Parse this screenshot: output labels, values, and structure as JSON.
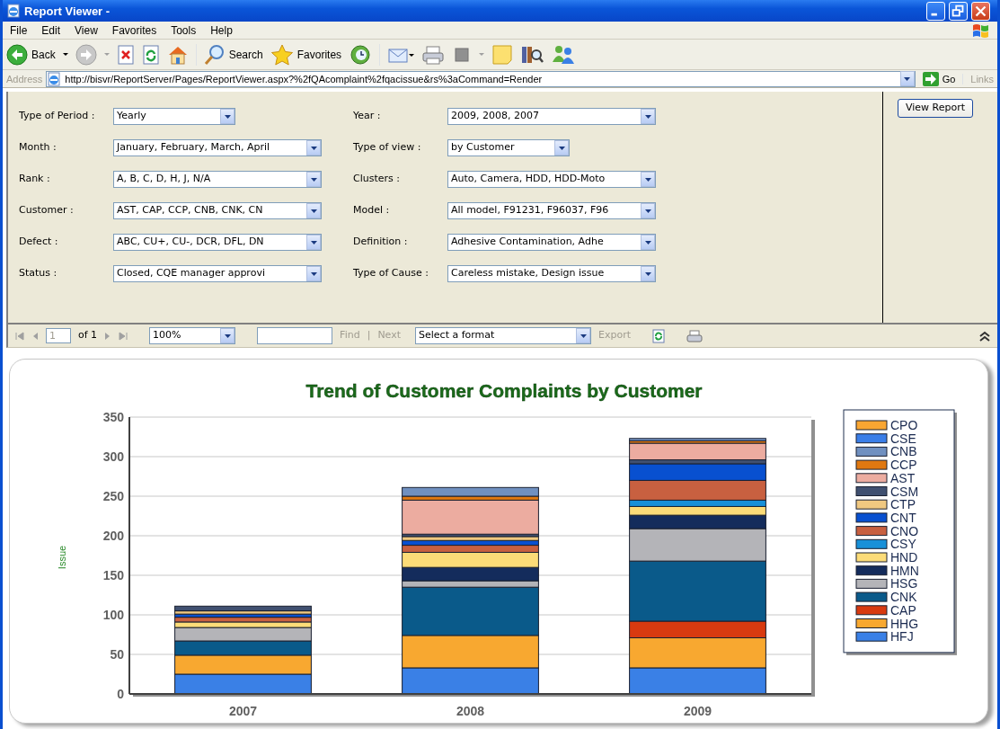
{
  "window": {
    "title": "Report Viewer -"
  },
  "menu": [
    "File",
    "Edit",
    "View",
    "Favorites",
    "Tools",
    "Help"
  ],
  "toolbar": {
    "back_label": "Back",
    "search_label": "Search",
    "favorites_label": "Favorites"
  },
  "address_bar": {
    "label": "Address",
    "url": "http://bisvr/ReportServer/Pages/ReportViewer.aspx?%2fQAcomplaint%2fqacissue&rs%3aCommand=Render",
    "go_label": "Go",
    "links_label": "Links"
  },
  "parameters": [
    {
      "label": "Type of Period :",
      "value": "Yearly",
      "kind": "short"
    },
    {
      "label": "Year :",
      "value": "2009, 2008, 2007",
      "kind": "wide"
    },
    {
      "label": "Month :",
      "value": "January, February, March, April",
      "kind": "wide"
    },
    {
      "label": "Type of view :",
      "value": "by Customer",
      "kind": "short"
    },
    {
      "label": "Rank :",
      "value": "A, B, C, D, H, J, N/A",
      "kind": "wide"
    },
    {
      "label": "Clusters :",
      "value": "Auto, Camera, HDD, HDD-Moto",
      "kind": "wide"
    },
    {
      "label": "Customer :",
      "value": "AST, CAP, CCP, CNB, CNK, CN",
      "kind": "wide"
    },
    {
      "label": "Model :",
      "value": "All model, F91231, F96037, F96",
      "kind": "wide"
    },
    {
      "label": "Defect :",
      "value": "ABC, CU+, CU-, DCR, DFL, DN",
      "kind": "wide"
    },
    {
      "label": "Definition :",
      "value": "Adhesive Contamination, Adhe",
      "kind": "wide"
    },
    {
      "label": "Status :",
      "value": "Closed, CQE manager approvi",
      "kind": "wide"
    },
    {
      "label": "Type of Cause :",
      "value": "Careless mistake, Design issue",
      "kind": "wide"
    }
  ],
  "view_report_button": "View Report",
  "report_toolbar": {
    "page": "1",
    "page_count": "of 1",
    "zoom": "100%",
    "find": {
      "label": "Find",
      "disabled": true
    },
    "separator": "|",
    "next": {
      "label": "Next",
      "disabled": true
    },
    "format": "Select a format",
    "export": {
      "label": "Export",
      "disabled": true
    }
  },
  "report_chart": {
    "chart_data": {
      "type": "bar",
      "title": "Trend of Customer Complaints by Customer",
      "ylabel": "Issue",
      "categories": [
        "2007",
        "2008",
        "2009"
      ],
      "stacked": true,
      "grid": true,
      "legend": true,
      "ylim": [
        0,
        350
      ],
      "yticks": [
        0,
        50,
        100,
        150,
        200,
        250,
        300,
        350
      ],
      "series": [
        {
          "name": "HFJ",
          "color": "#3a80e6",
          "values": [
            25,
            33,
            33
          ]
        },
        {
          "name": "HHG",
          "color": "#f8a830",
          "values": [
            24,
            41,
            38
          ]
        },
        {
          "name": "CAP",
          "color": "#d83a10",
          "values": [
            0,
            0,
            21
          ]
        },
        {
          "name": "CNK",
          "color": "#0a5a8a",
          "values": [
            18,
            61,
            76
          ]
        },
        {
          "name": "HSG",
          "color": "#b4b4b8",
          "values": [
            17,
            8,
            41
          ]
        },
        {
          "name": "HMN",
          "color": "#142c5c",
          "values": [
            0,
            17,
            17
          ]
        },
        {
          "name": "HND",
          "color": "#fcdc78",
          "values": [
            7,
            19,
            11
          ]
        },
        {
          "name": "CSY",
          "color": "#1890d8",
          "values": [
            0,
            0,
            8
          ]
        },
        {
          "name": "CNO",
          "color": "#c86040",
          "values": [
            6,
            9,
            25
          ]
        },
        {
          "name": "CNT",
          "color": "#0850d0",
          "values": [
            4,
            6,
            21
          ]
        },
        {
          "name": "CTP",
          "color": "#f0c880",
          "values": [
            4,
            5,
            0
          ]
        },
        {
          "name": "CSM",
          "color": "#405070",
          "values": [
            6,
            3,
            5
          ]
        },
        {
          "name": "AST",
          "color": "#ecaca0",
          "values": [
            0,
            43,
            21
          ]
        },
        {
          "name": "CCP",
          "color": "#e07810",
          "values": [
            0,
            5,
            3
          ]
        },
        {
          "name": "CNB",
          "color": "#7090c0",
          "values": [
            0,
            11,
            3
          ]
        },
        {
          "name": "CSE",
          "color": "#3a7ee8",
          "values": [
            0,
            0,
            0
          ]
        },
        {
          "name": "CPO",
          "color": "#f9a632",
          "values": [
            0,
            0,
            0
          ]
        }
      ]
    }
  }
}
